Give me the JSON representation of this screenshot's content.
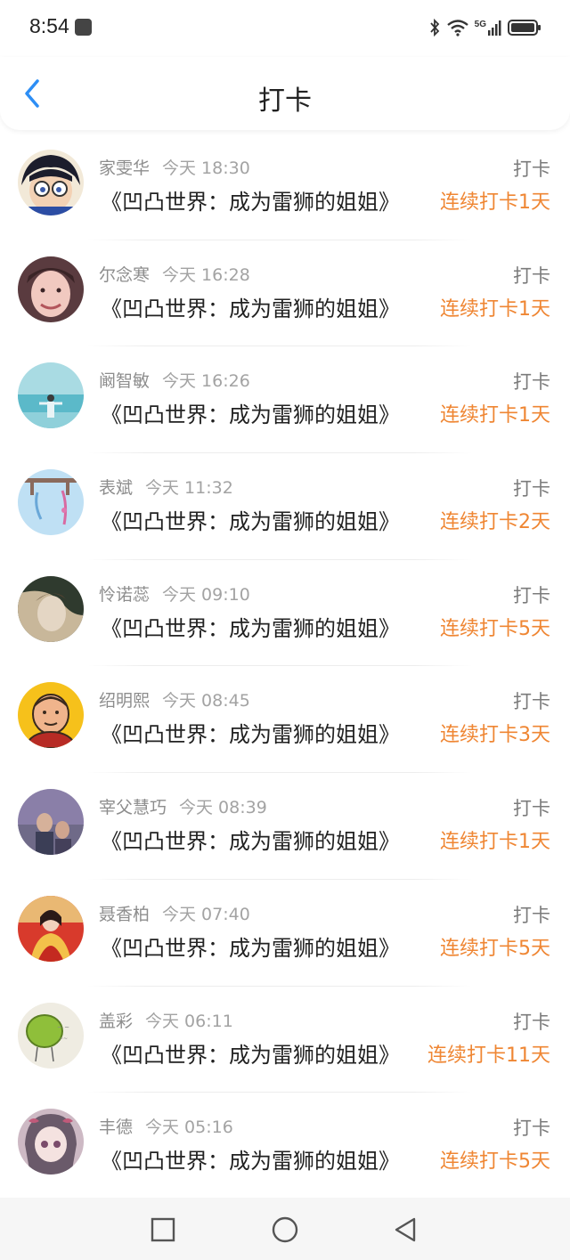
{
  "status_bar": {
    "time": "8:54",
    "network": "5G",
    "icons": [
      "notification-icon",
      "bluetooth-icon",
      "wifi-icon",
      "signal-icon",
      "battery-icon"
    ]
  },
  "header": {
    "title": "打卡",
    "back_icon": "chevron-left-icon"
  },
  "list": [
    {
      "name": "家雯华",
      "time": "今天 18:30",
      "book": "《凹凸世界：成为雷狮的姐姐》",
      "action": "打卡",
      "streak": "连续打卡1天"
    },
    {
      "name": "尔念寒",
      "time": "今天 16:28",
      "book": "《凹凸世界：成为雷狮的姐姐》",
      "action": "打卡",
      "streak": "连续打卡1天"
    },
    {
      "name": "阚智敏",
      "time": "今天 16:26",
      "book": "《凹凸世界：成为雷狮的姐姐》",
      "action": "打卡",
      "streak": "连续打卡1天"
    },
    {
      "name": "表斌",
      "time": "今天 11:32",
      "book": "《凹凸世界：成为雷狮的姐姐》",
      "action": "打卡",
      "streak": "连续打卡2天"
    },
    {
      "name": "怜诺蕊",
      "time": "今天 09:10",
      "book": "《凹凸世界：成为雷狮的姐姐》",
      "action": "打卡",
      "streak": "连续打卡5天"
    },
    {
      "name": "绍明熙",
      "time": "今天 08:45",
      "book": "《凹凸世界：成为雷狮的姐姐》",
      "action": "打卡",
      "streak": "连续打卡3天"
    },
    {
      "name": "宰父慧巧",
      "time": "今天 08:39",
      "book": "《凹凸世界：成为雷狮的姐姐》",
      "action": "打卡",
      "streak": "连续打卡1天"
    },
    {
      "name": "聂香柏",
      "time": "今天 07:40",
      "book": "《凹凸世界：成为雷狮的姐姐》",
      "action": "打卡",
      "streak": "连续打卡5天"
    },
    {
      "name": "盖彩",
      "time": "今天 06:11",
      "book": "《凹凸世界：成为雷狮的姐姐》",
      "action": "打卡",
      "streak": "连续打卡11天"
    },
    {
      "name": "丰德",
      "time": "今天 05:16",
      "book": "《凹凸世界：成为雷狮的姐姐》",
      "action": "打卡",
      "streak": "连续打卡5天"
    }
  ],
  "nav_bar": {
    "icons": [
      "square-recents-icon",
      "circle-home-icon",
      "triangle-back-icon"
    ]
  },
  "colors": {
    "accent_blue": "#2d8ef5",
    "streak_orange": "#ef8633",
    "text_dark": "#222222",
    "text_gray": "#8d8d8d"
  }
}
